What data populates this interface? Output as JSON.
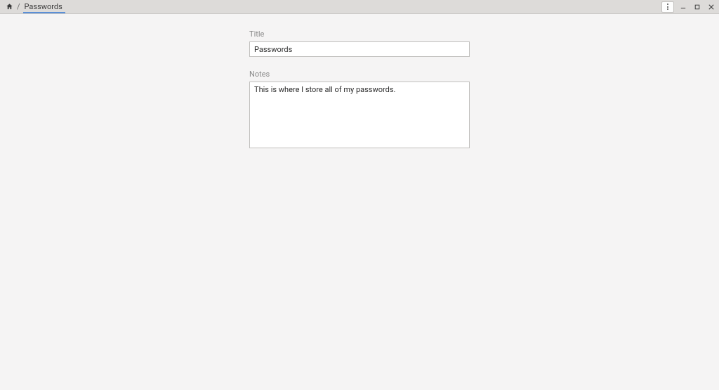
{
  "breadcrumb": {
    "separator": "/",
    "current": "Passwords"
  },
  "form": {
    "title_label": "Title",
    "title_value": "Passwords",
    "notes_label": "Notes",
    "notes_value": "This is where I store all of my passwords."
  }
}
